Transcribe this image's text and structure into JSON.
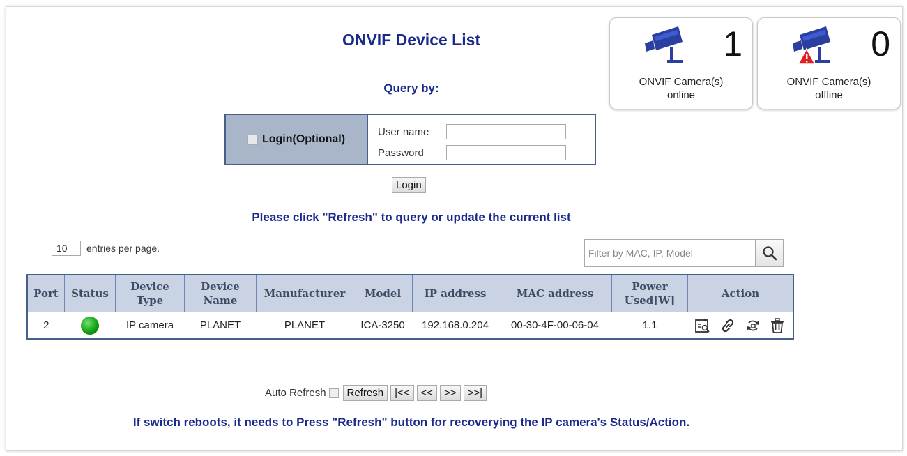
{
  "title": "ONVIF Device List",
  "query_by": "Query by:",
  "login": {
    "checkbox_label": "Login(Optional)",
    "username_label": "User name",
    "username_value": "",
    "password_label": "Password",
    "password_value": "",
    "button": "Login"
  },
  "hint": "Please click \"Refresh\" to query or update the current list",
  "per_page": {
    "value": "10",
    "label": "entries per page."
  },
  "filter": {
    "placeholder": "Filter by MAC, IP, Model",
    "icon": "search-icon"
  },
  "cards": {
    "online": {
      "count": "1",
      "label_line1": "ONVIF Camera(s)",
      "label_line2": "online",
      "icon": "camera-icon"
    },
    "offline": {
      "count": "0",
      "label_line1": "ONVIF Camera(s)",
      "label_line2": "offline",
      "icon": "camera-warning-icon"
    }
  },
  "table": {
    "headers": {
      "port": "Port",
      "status": "Status",
      "device_type_1": "Device",
      "device_type_2": "Type",
      "device_name_1": "Device",
      "device_name_2": "Name",
      "manufacturer": "Manufacturer",
      "model": "Model",
      "ip": "IP address",
      "mac": "MAC address",
      "power_1": "Power",
      "power_2": "Used[W]",
      "action": "Action"
    },
    "rows": [
      {
        "port": "2",
        "status": "online",
        "device_type": "IP camera",
        "device_name": "PLANET",
        "manufacturer": "PLANET",
        "model": "ICA-3250",
        "ip": "192.168.0.204",
        "mac": "00-30-4F-00-06-04",
        "power": "1.1",
        "actions": [
          "view-icon",
          "link-icon",
          "reboot-icon",
          "delete-icon"
        ]
      }
    ]
  },
  "controls": {
    "auto_refresh": "Auto Refresh",
    "refresh": "Refresh",
    "first": "|<<",
    "prev": "<<",
    "next": ">>",
    "last": ">>|"
  },
  "note": "If switch reboots, it needs to Press \"Refresh\" button for recoverying the IP camera's Status/Action.",
  "colors": {
    "heading": "#1a2a8c",
    "table_border": "#46608a",
    "header_bg": "#c9d3e4",
    "status_online": "#0d9b0d",
    "warning": "#e02020"
  }
}
